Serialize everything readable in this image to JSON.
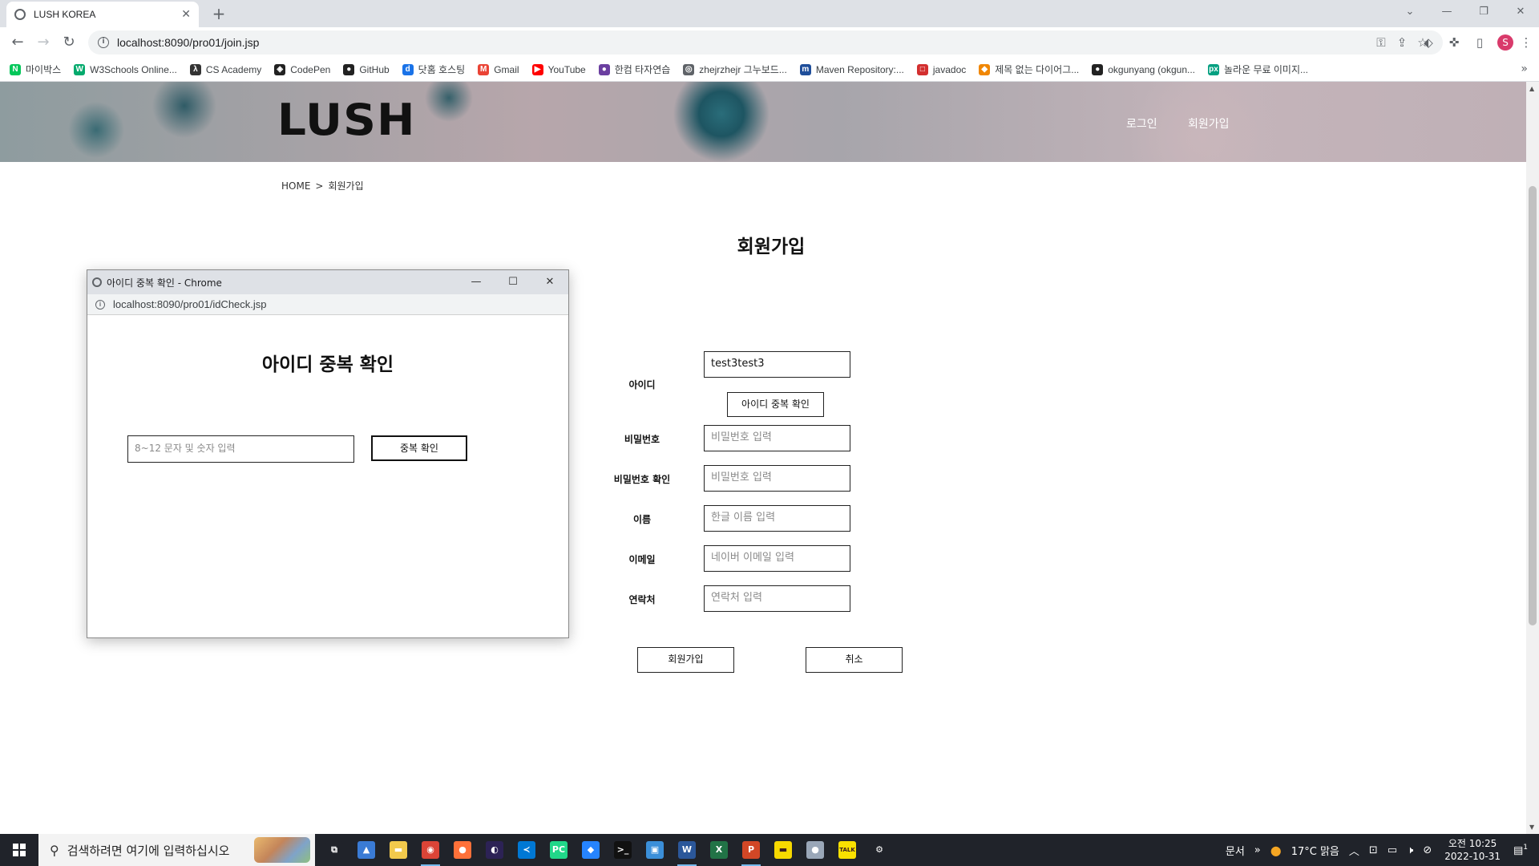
{
  "browser": {
    "tab_title": "LUSH KOREA",
    "url": "localhost:8090/pro01/join.jsp",
    "profile_initial": "S",
    "bookmarks": [
      {
        "label": "마이박스",
        "color": "#03c75a",
        "glyph": "N"
      },
      {
        "label": "W3Schools Online...",
        "color": "#04aa6d",
        "glyph": "W"
      },
      {
        "label": "CS Academy",
        "color": "#333333",
        "glyph": "λ"
      },
      {
        "label": "CodePen",
        "color": "#222222",
        "glyph": "◈"
      },
      {
        "label": "GitHub",
        "color": "#222222",
        "glyph": "●"
      },
      {
        "label": "닷홈 호스팅",
        "color": "#1a73e8",
        "glyph": "d"
      },
      {
        "label": "Gmail",
        "color": "#ea4335",
        "glyph": "M"
      },
      {
        "label": "YouTube",
        "color": "#ff0000",
        "glyph": "▶"
      },
      {
        "label": "한컴 타자연습",
        "color": "#6b3fa0",
        "glyph": "●"
      },
      {
        "label": "zhejrzhejr 그누보드...",
        "color": "#5f6368",
        "glyph": "◎"
      },
      {
        "label": "Maven Repository:...",
        "color": "#1f4e9a",
        "glyph": "m"
      },
      {
        "label": "javadoc",
        "color": "#d32f2f",
        "glyph": "□"
      },
      {
        "label": "제목 없는 다이어그...",
        "color": "#f08705",
        "glyph": "◆"
      },
      {
        "label": "okgunyang (okgun...",
        "color": "#222222",
        "glyph": "●"
      },
      {
        "label": "놀라운 무료 이미지...",
        "color": "#05a081",
        "glyph": "px"
      }
    ]
  },
  "site": {
    "logo": "LUSH",
    "nav_login": "로그인",
    "nav_join": "회원가입",
    "breadcrumb_home": "HOME",
    "breadcrumb_sep": ">",
    "breadcrumb_current": "회원가입",
    "heading": "회원가입"
  },
  "join_form": {
    "id_label": "아이디",
    "id_value": "test3test3",
    "id_check_button": "아이디 중복 확인",
    "password_label": "비밀번호",
    "password_placeholder": "비밀번호 입력",
    "password_confirm_label": "비밀번호 확인",
    "password_confirm_placeholder": "비밀번호 입력",
    "name_label": "이름",
    "name_placeholder": "한글 이름 입력",
    "email_label": "이메일",
    "email_placeholder": "네이버 이메일 입력",
    "phone_label": "연락처",
    "phone_placeholder": "연락처 입력",
    "submit_button": "회원가입",
    "cancel_button": "취소"
  },
  "popup": {
    "window_title": "아이디 중복 확인 - Chrome",
    "url": "localhost:8090/pro01/idCheck.jsp",
    "heading": "아이디 중복 확인",
    "input_placeholder": "8~12 문자 및 숫자 입력",
    "check_button": "중복 확인"
  },
  "taskbar": {
    "search_placeholder": "검색하려면 여기에 입력하십시오",
    "apps": [
      {
        "name": "task-view",
        "color": "#20232a",
        "glyph": "⧉",
        "active": false
      },
      {
        "name": "app-blue-arrow",
        "color": "#3a7bd5",
        "glyph": "▲",
        "active": false
      },
      {
        "name": "file-explorer",
        "color": "#f2c94c",
        "glyph": "▬",
        "active": false
      },
      {
        "name": "chrome",
        "color": "#db4437",
        "glyph": "◉",
        "active": true
      },
      {
        "name": "firefox",
        "color": "#ff7139",
        "glyph": "●",
        "active": false
      },
      {
        "name": "eclipse",
        "color": "#2c2255",
        "glyph": "◐",
        "active": false
      },
      {
        "name": "vscode",
        "color": "#0078d4",
        "glyph": "≺",
        "active": false
      },
      {
        "name": "pycharm",
        "color": "#21d789",
        "glyph": "PC",
        "active": false
      },
      {
        "name": "sourcetree",
        "color": "#2684ff",
        "glyph": "◆",
        "active": false
      },
      {
        "name": "terminal",
        "color": "#111111",
        "glyph": ">_",
        "active": false
      },
      {
        "name": "app-blue-square",
        "color": "#3b8fd9",
        "glyph": "▣",
        "active": false
      },
      {
        "name": "word",
        "color": "#2b579a",
        "glyph": "W",
        "active": true
      },
      {
        "name": "excel",
        "color": "#217346",
        "glyph": "X",
        "active": false
      },
      {
        "name": "powerpoint",
        "color": "#d24726",
        "glyph": "P",
        "active": true
      },
      {
        "name": "sticky-notes",
        "color": "#f7d900",
        "glyph": "▬",
        "active": false
      },
      {
        "name": "app-painter",
        "color": "#9aa7b8",
        "glyph": "●",
        "active": false
      },
      {
        "name": "kakaotalk",
        "color": "#fae100",
        "glyph": "TALK",
        "active": false
      },
      {
        "name": "settings",
        "color": "#20232a",
        "glyph": "⚙",
        "active": false
      }
    ],
    "tray_label": "문서",
    "weather": "17°C 맑음",
    "time": "오전 10:25",
    "date": "2022-10-31",
    "notification_count": "1"
  }
}
